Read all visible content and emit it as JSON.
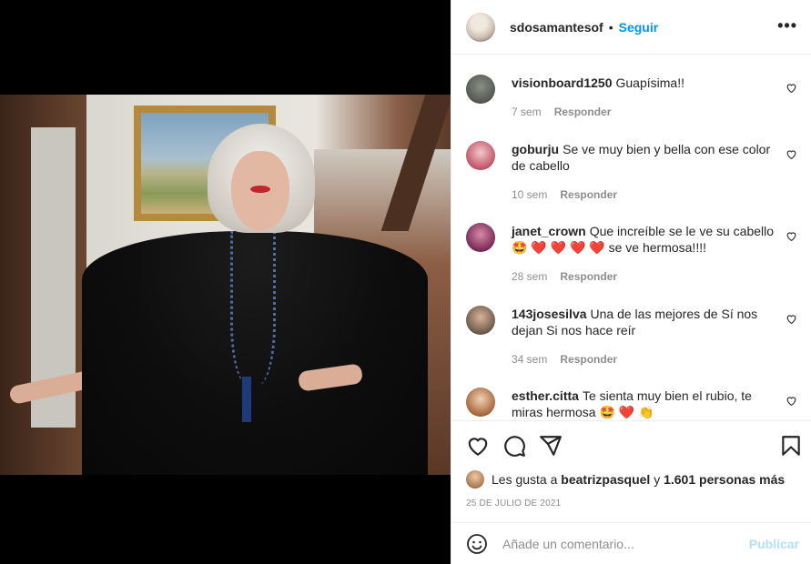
{
  "post": {
    "username": "sdosamantesof",
    "separator": "•",
    "follow_label": "Seguir",
    "more_label": "•••"
  },
  "comments": [
    {
      "username": "visionboard1250",
      "text": "Guapísima!!",
      "time": "7 sem",
      "reply": "Responder"
    },
    {
      "username": "goburju",
      "text": "Se ve muy bien y bella con ese color de cabello",
      "time": "10 sem",
      "reply": "Responder"
    },
    {
      "username": "janet_crown",
      "text": "Que increíble se le ve su cabello 🤩 ❤️ ❤️ ❤️ ❤️ se ve hermosa!!!!",
      "time": "28 sem",
      "reply": "Responder"
    },
    {
      "username": "143josesilva",
      "text": "Una de las mejores de Sí nos dejan Si nos hace reír",
      "time": "34 sem",
      "reply": "Responder"
    },
    {
      "username": "esther.citta",
      "text": "Te sienta muy bien el rubio, te miras hermosa 🤩 ❤️ 👏",
      "time": "",
      "reply": ""
    }
  ],
  "likes": {
    "prefix": "Les gusta a",
    "user": "beatrizpasquel",
    "connector": "y",
    "count": "1.601 personas más"
  },
  "date": "25 DE JULIO DE 2021",
  "add_comment": {
    "placeholder": "Añade un comentario...",
    "post_label": "Publicar"
  },
  "icons": [
    "heart-icon",
    "comment-icon",
    "share-icon",
    "bookmark-icon",
    "emoji-icon",
    "more-icon"
  ],
  "colors": {
    "accent": "#0095f6",
    "post_disabled": "#b2dffc",
    "muted": "#8e8e8e"
  }
}
